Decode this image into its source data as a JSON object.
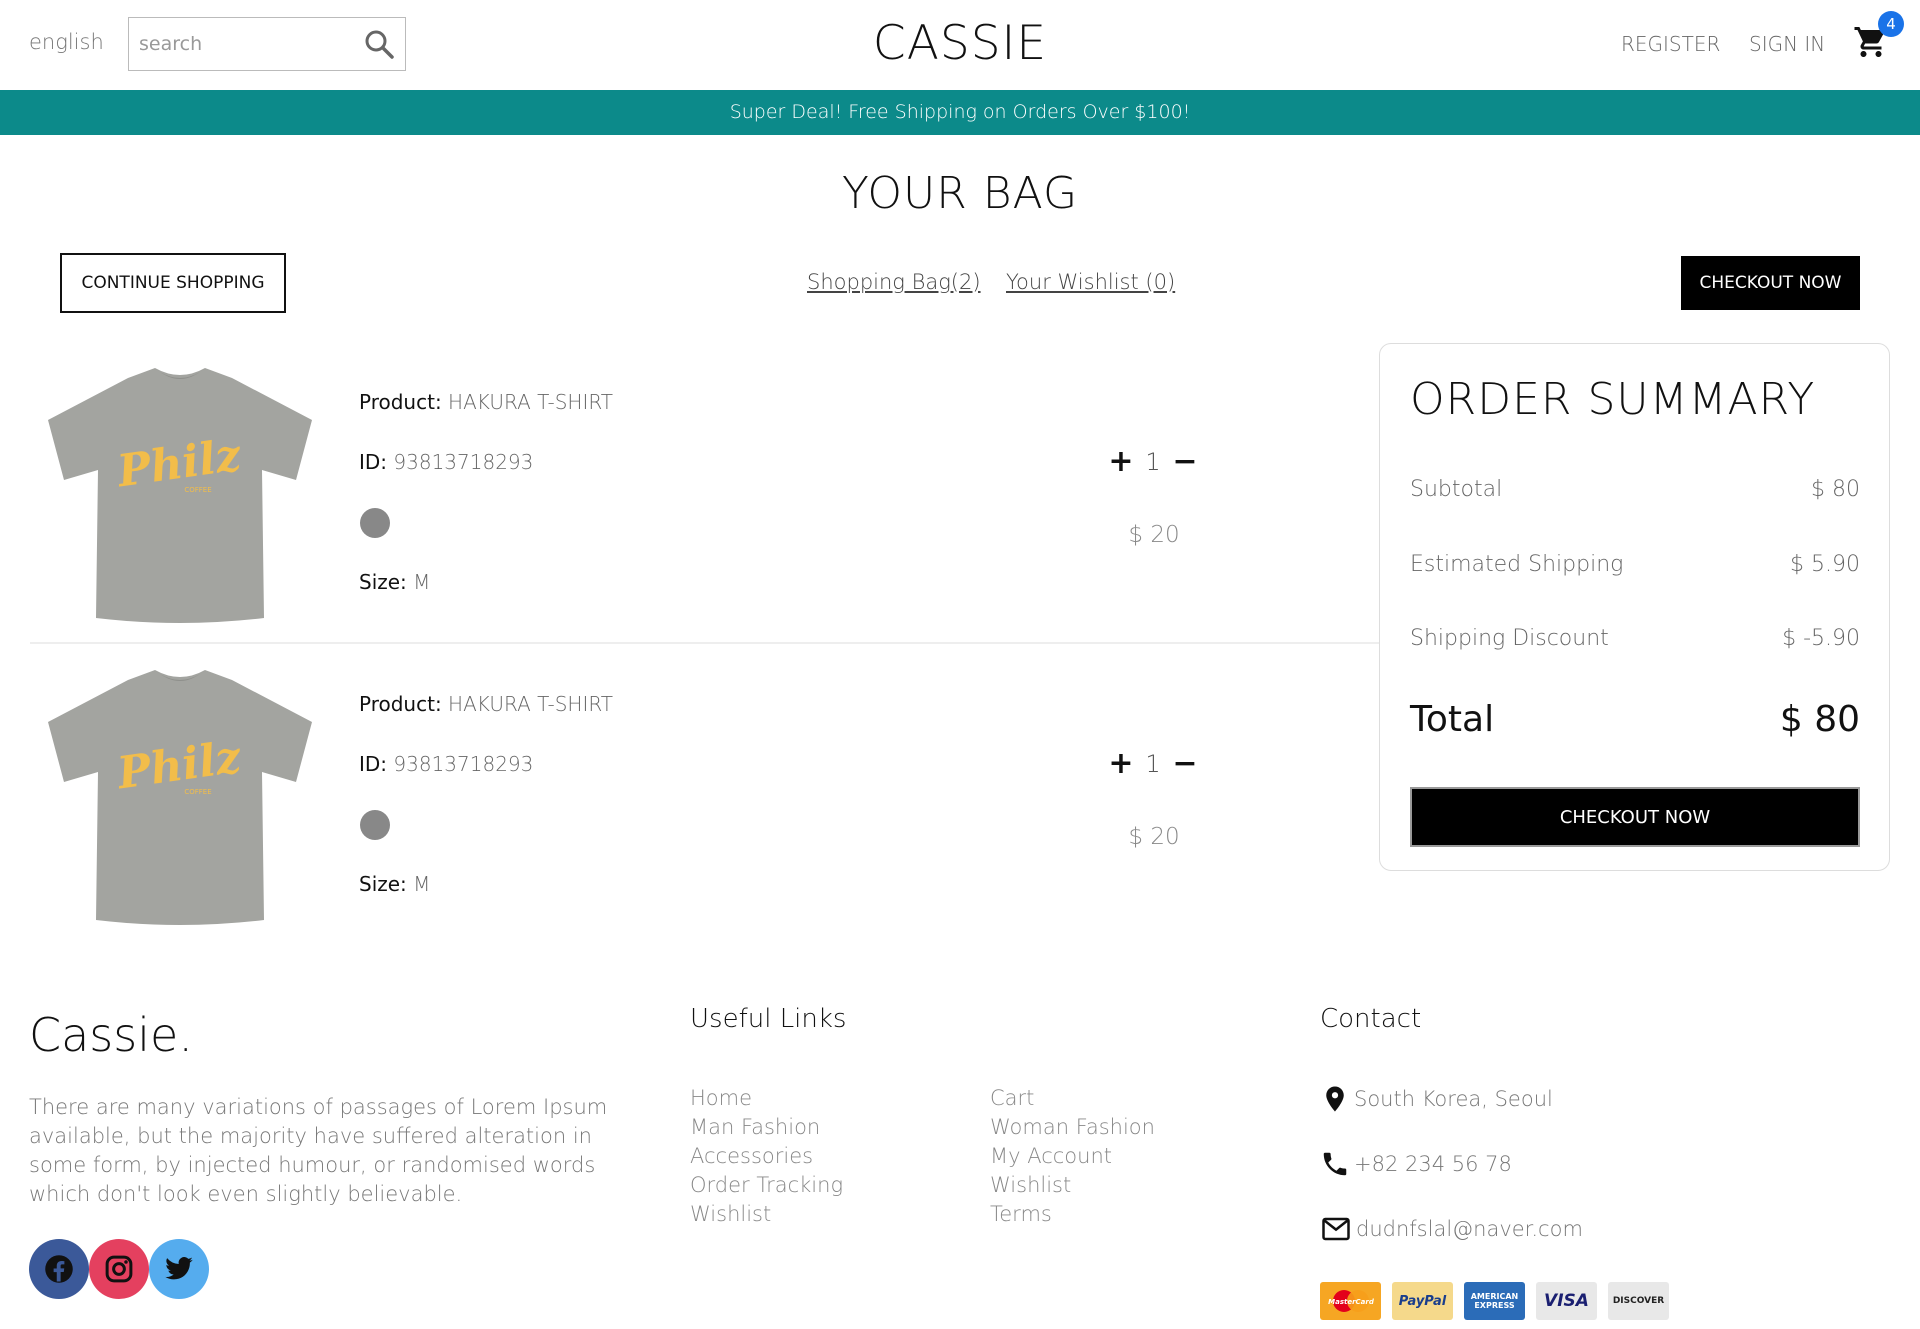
{
  "header": {
    "language": "english",
    "search_placeholder": "search",
    "logo": "CASSIE",
    "register": "REGISTER",
    "sign_in": "SIGN IN",
    "cart_count": "4"
  },
  "promo": "Super Deal! Free Shipping on Orders Over $100!",
  "bag": {
    "title": "YOUR BAG",
    "continue_label": "CONTINUE SHOPPING",
    "tab_bag": "Shopping Bag(2)",
    "tab_wishlist": "Your Wishlist (0)",
    "checkout_label": "CHECKOUT NOW"
  },
  "products": [
    {
      "product_label": "Product:",
      "name": "HAKURA T-SHIRT",
      "id_label": "ID:",
      "id": "93813718293",
      "color": "#888888",
      "size_label": "Size:",
      "size": "M",
      "quantity": "1",
      "price": "$ 20"
    },
    {
      "product_label": "Product:",
      "name": "HAKURA T-SHIRT",
      "id_label": "ID:",
      "id": "93813718293",
      "color": "#888888",
      "size_label": "Size:",
      "size": "M",
      "quantity": "1",
      "price": "$ 20"
    }
  ],
  "summary": {
    "title": "ORDER SUMMARY",
    "rows": [
      {
        "label": "Subtotal",
        "value": "$ 80"
      },
      {
        "label": "Estimated Shipping",
        "value": "$ 5.90"
      },
      {
        "label": "Shipping Discount",
        "value": "$ -5.90"
      }
    ],
    "total_label": "Total",
    "total_value": "$ 80",
    "checkout_label": "CHECKOUT NOW"
  },
  "footer": {
    "logo": "Cassie.",
    "description": "There are many variations of passages of Lorem Ipsum available, but the majority have suffered alteration in some form, by injected humour, or randomised words which don't look even slightly believable.",
    "links_title": "Useful Links",
    "links_col1": [
      "Home",
      "Man Fashion",
      "Accessories",
      "Order Tracking",
      "Wishlist"
    ],
    "links_col2": [
      "Cart",
      "Woman Fashion",
      "My Account",
      "Wishlist",
      "Terms"
    ],
    "contact_title": "Contact",
    "address": "South Korea, Seoul",
    "phone": "+82 234 56 78",
    "email": "dudnfslal@naver.com",
    "payments": [
      "MasterCard",
      "PayPal",
      "AMERICAN EXPRESS",
      "VISA",
      "DISCOVER"
    ]
  },
  "colors": {
    "promo_bg": "#0c8a8a",
    "badge": "#1a73e8",
    "facebook": "#3b5999",
    "instagram": "#e4405f",
    "twitter": "#55acee"
  }
}
